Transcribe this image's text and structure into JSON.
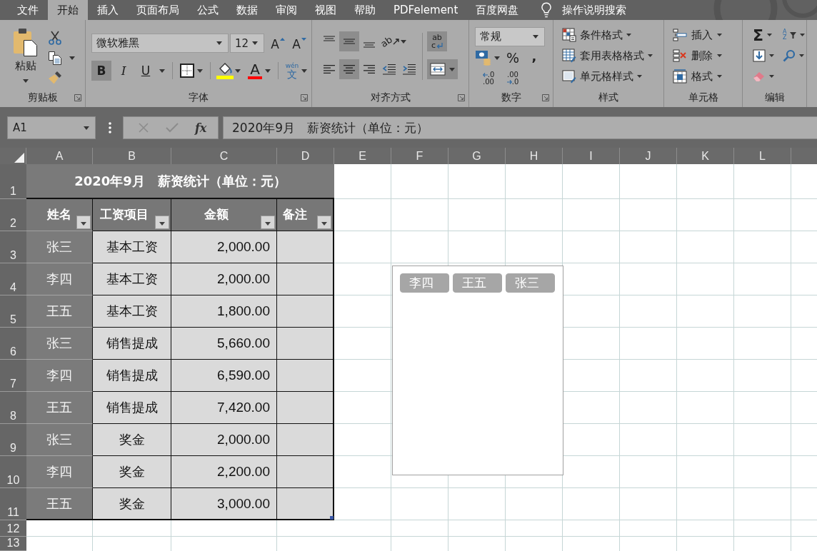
{
  "menu_tabs": [
    {
      "label": "文件",
      "selected": false
    },
    {
      "label": "开始",
      "selected": true
    },
    {
      "label": "插入",
      "selected": false
    },
    {
      "label": "页面布局",
      "selected": false
    },
    {
      "label": "公式",
      "selected": false
    },
    {
      "label": "数据",
      "selected": false
    },
    {
      "label": "审阅",
      "selected": false
    },
    {
      "label": "视图",
      "selected": false
    },
    {
      "label": "帮助",
      "selected": false
    },
    {
      "label": "PDFelement",
      "selected": false
    },
    {
      "label": "百度网盘",
      "selected": false
    }
  ],
  "tell_me": {
    "placeholder": "操作说明搜索"
  },
  "ribbon": {
    "clipboard": {
      "label": "剪贴板",
      "paste": "粘贴"
    },
    "font": {
      "label": "字体",
      "font_name": "微软雅黑",
      "font_size": "12",
      "grow": "A",
      "shrink": "A",
      "styles": [
        {
          "kind": "bold",
          "glyph": "B",
          "on": true
        },
        {
          "kind": "italic",
          "glyph": "I",
          "on": false
        },
        {
          "kind": "underline",
          "glyph": "U",
          "on": false
        }
      ],
      "font_color": "A",
      "phonetic": {
        "pinyin": "wén",
        "char": "文"
      }
    },
    "alignment": {
      "label": "对齐方式",
      "orientation": "ab",
      "vertical": [
        {
          "kind": "top",
          "selected": false
        },
        {
          "kind": "middle",
          "selected": true
        },
        {
          "kind": "bottom",
          "selected": false
        }
      ],
      "horizontal": [
        {
          "kind": "left",
          "selected": false
        },
        {
          "kind": "center",
          "selected": true
        },
        {
          "kind": "right",
          "selected": false
        }
      ],
      "wrap_text": {
        "top": "ab",
        "bottom": "c",
        "on": true
      },
      "merge_center": {
        "on": true
      }
    },
    "number": {
      "label": "数字",
      "format": "常规",
      "percent": "%",
      "comma": ",",
      "increase_decimal": [
        ".0",
        ".00"
      ],
      "decrease_decimal": [
        ".00",
        ".0"
      ]
    },
    "styles": {
      "label": "样式",
      "buttons": [
        "条件格式",
        "套用表格格式",
        "单元格样式"
      ]
    },
    "cells": {
      "label": "单元格",
      "buttons": [
        "插入",
        "删除",
        "格式"
      ]
    },
    "editing": {
      "label": "编辑",
      "sum": "Σ",
      "sort": [
        "A",
        "Z"
      ]
    }
  },
  "formula_bar": {
    "name_box": "A1",
    "function": "fx",
    "formula": "2020年9月　薪资统计（单位：元）"
  },
  "sheet": {
    "columns": [
      "A",
      "B",
      "C",
      "D",
      "E",
      "F",
      "G",
      "H",
      "I",
      "J",
      "K",
      "L"
    ],
    "rows": [
      "1",
      "2",
      "3",
      "4",
      "5",
      "6",
      "7",
      "8",
      "9",
      "10",
      "11",
      "12",
      "13"
    ]
  },
  "table": {
    "title": "2020年9月　薪资统计（单位：元）",
    "headers": [
      "姓名",
      "工资项目",
      "金额",
      "备注"
    ],
    "rows": [
      {
        "name": "张三",
        "item": "基本工资",
        "amount": "2,000.00"
      },
      {
        "name": "李四",
        "item": "基本工资",
        "amount": "2,000.00"
      },
      {
        "name": "王五",
        "item": "基本工资",
        "amount": "1,800.00"
      },
      {
        "name": "张三",
        "item": "销售提成",
        "amount": "5,660.00"
      },
      {
        "name": "李四",
        "item": "销售提成",
        "amount": "6,590.00"
      },
      {
        "name": "王五",
        "item": "销售提成",
        "amount": "7,420.00"
      },
      {
        "name": "张三",
        "item": "奖金",
        "amount": "2,000.00"
      },
      {
        "name": "李四",
        "item": "奖金",
        "amount": "2,200.00"
      },
      {
        "name": "王五",
        "item": "奖金",
        "amount": "3,000.00"
      }
    ]
  },
  "slicer": {
    "items": [
      {
        "label": "李四",
        "selected": true
      },
      {
        "label": "王五",
        "selected": true
      },
      {
        "label": "张三",
        "selected": true
      }
    ]
  }
}
